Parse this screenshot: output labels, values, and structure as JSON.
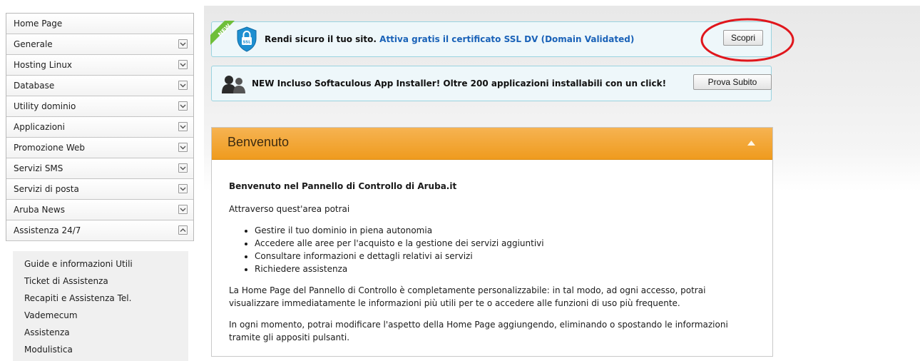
{
  "sidebar": {
    "items": [
      {
        "label": "Home Page",
        "chevron": "none"
      },
      {
        "label": "Generale",
        "chevron": "down"
      },
      {
        "label": "Hosting Linux",
        "chevron": "down"
      },
      {
        "label": "Database",
        "chevron": "down"
      },
      {
        "label": "Utility dominio",
        "chevron": "down"
      },
      {
        "label": "Applicazioni",
        "chevron": "down"
      },
      {
        "label": "Promozione Web",
        "chevron": "down"
      },
      {
        "label": "Servizi SMS",
        "chevron": "down"
      },
      {
        "label": "Servizi di posta",
        "chevron": "down"
      },
      {
        "label": "Aruba News",
        "chevron": "down"
      },
      {
        "label": "Assistenza 24/7",
        "chevron": "up"
      }
    ],
    "submenu": [
      "Guide e informazioni Utili",
      "Ticket di Assistenza",
      "Recapiti e Assistenza Tel.",
      "Vademecum",
      "Assistenza",
      "Modulistica"
    ]
  },
  "banners": {
    "ssl": {
      "ribbon": "NEW",
      "icon": "ssl-shield-icon",
      "text_bold": "Rendi sicuro il tuo sito.",
      "text_link": "Attiva gratis il certificato SSL DV (Domain Validated)",
      "button": "Scopri"
    },
    "softaculous": {
      "icon": "users-icon",
      "text": "NEW Incluso Softaculous App Installer! Oltre 200 applicazioni installabili con un click!",
      "button": "Prova Subito"
    }
  },
  "welcome": {
    "title": "Benvenuto",
    "heading": "Benvenuto nel Pannello di Controllo di Aruba.it",
    "intro": "Attraverso quest'area potrai",
    "bullets": [
      "Gestire il tuo dominio in piena autonomia",
      "Accedere alle aree per l'acquisto e la gestione dei servizi aggiuntivi",
      "Consultare informazioni e dettagli relativi ai servizi",
      "Richiedere assistenza"
    ],
    "paragraph1": "La Home Page del Pannello di Controllo è completamente personalizzabile: in tal modo, ad ogni accesso, potrai visualizzare immediatamente le informazioni più utili per te o accedere alle funzioni di uso più frequente.",
    "paragraph2": "In ogni momento, potrai modificare l'aspetto della Home Page aggiungendo, eliminando o spostando le informazioni tramite gli appositi pulsanti."
  },
  "colors": {
    "accent_orange": "#ef9b1e",
    "banner_bg": "#eef7fa",
    "banner_border": "#9ad3df",
    "link": "#1a62b8",
    "annotation_red": "#e0161c"
  }
}
